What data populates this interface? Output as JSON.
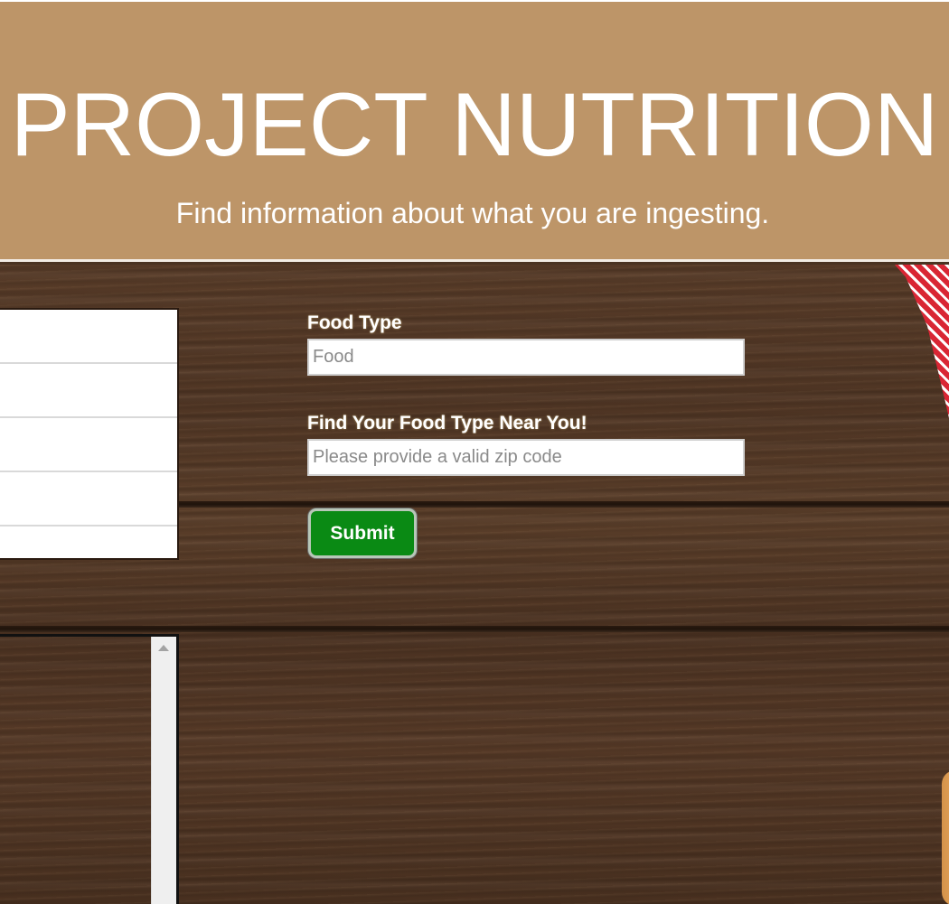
{
  "header": {
    "title": "PROJECT NUTRITION",
    "subtitle": "Find information about what you are ingesting."
  },
  "results_panel": {
    "rows": [
      "",
      "",
      "",
      "",
      ""
    ]
  },
  "form": {
    "food_type_label": "Food Type",
    "food_type_placeholder": "Food",
    "zip_label": "Find Your Food Type Near You!",
    "zip_placeholder": "Please provide a valid zip code",
    "submit_label": "Submit"
  },
  "colors": {
    "header_background": "#bd9568",
    "submit_button": "#0a8a14",
    "text_on_wood": "#ffffff"
  },
  "icons": {
    "scroll_up": "scroll-up-arrow-icon"
  }
}
